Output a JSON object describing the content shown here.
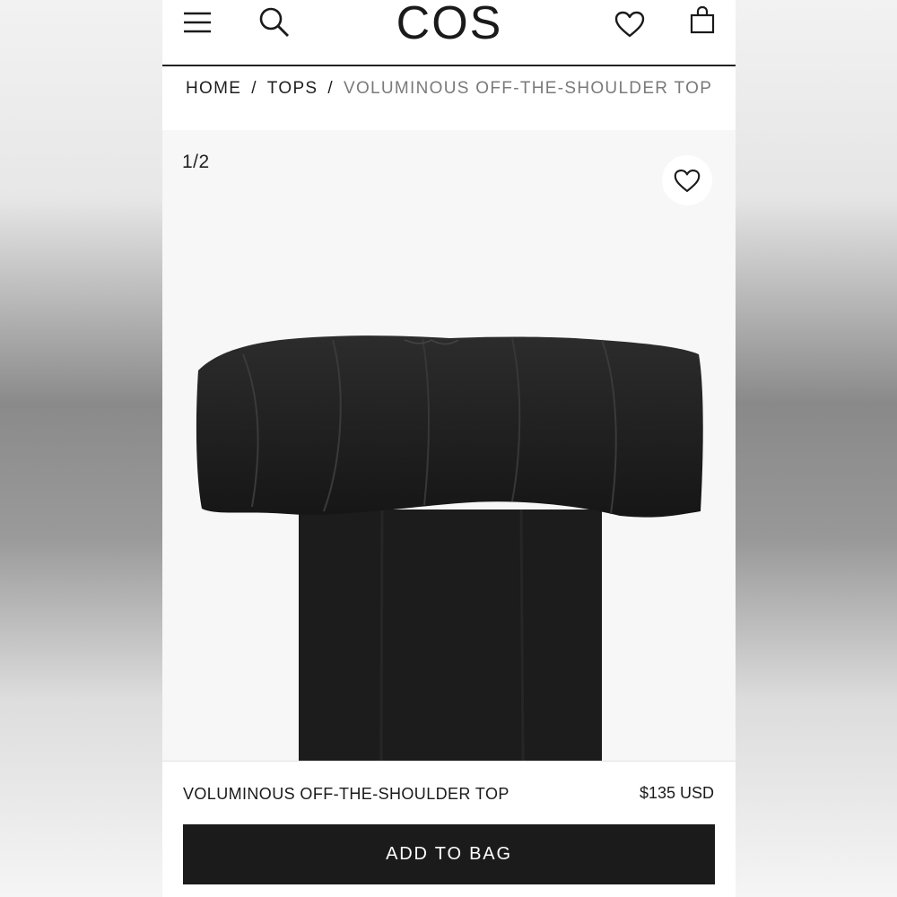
{
  "header": {
    "logo": "COS",
    "icons": [
      "menu-icon",
      "search-icon",
      "heart-icon",
      "bag-icon"
    ]
  },
  "breadcrumb": {
    "items": [
      "HOME",
      "TOPS",
      "VOLUMINOUS OFF-THE-SHOULDER TOP"
    ],
    "separator": "/"
  },
  "gallery": {
    "counter": "1/2",
    "favorite_icon": "heart-icon"
  },
  "product": {
    "name": "VOLUMINOUS OFF-THE-SHOULDER TOP",
    "price": "$135 USD",
    "add_to_bag_label": "ADD TO BAG"
  },
  "colors": {
    "primary": "#1b1b1b",
    "background": "#ffffff",
    "breadcrumb_current": "#7a7a7a",
    "gallery_bg": "#f7f7f7"
  }
}
